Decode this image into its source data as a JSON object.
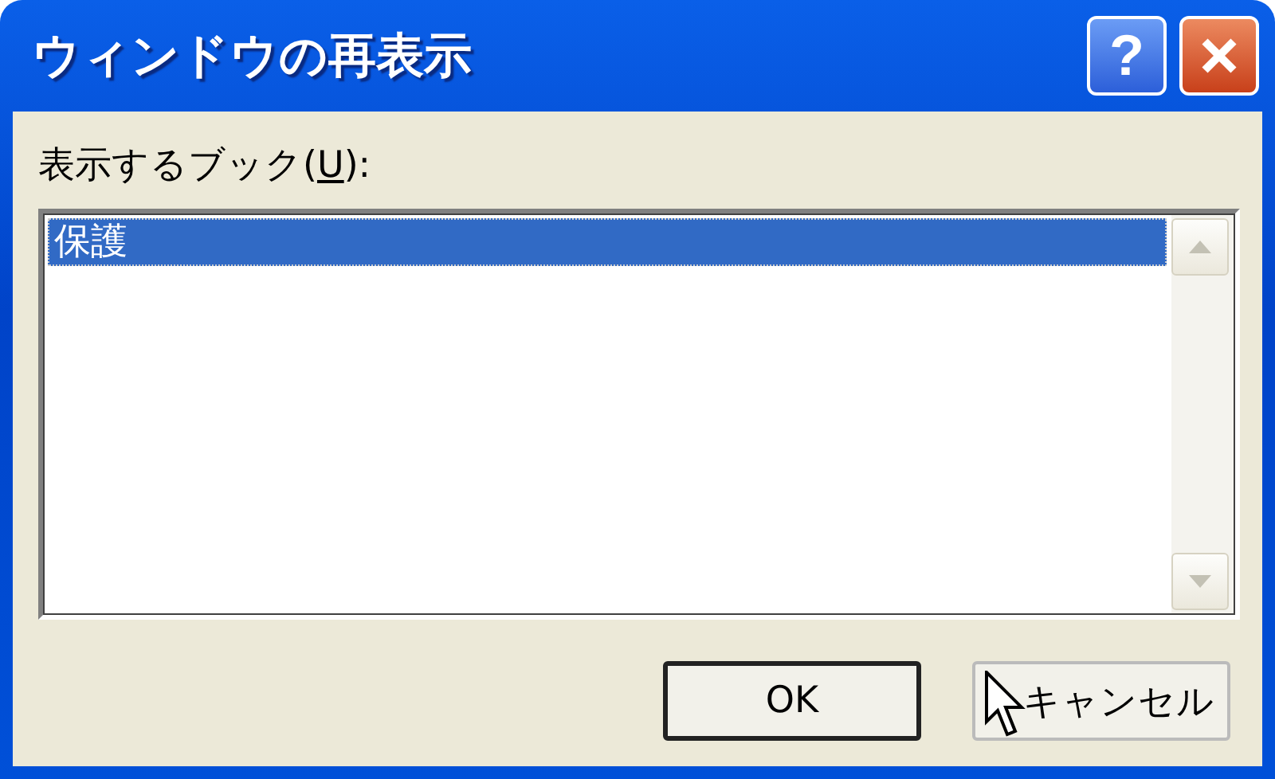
{
  "window": {
    "title": "ウィンドウの再表示"
  },
  "title_buttons": [
    {
      "kind": "help",
      "label": "?"
    },
    {
      "kind": "close"
    }
  ],
  "list_label": {
    "before": "表示するブック(",
    "mnemonic": "U",
    "after": "):"
  },
  "list": {
    "items": [
      {
        "label": "保護",
        "selected": true
      }
    ]
  },
  "buttons": [
    {
      "label": "OK",
      "default": true
    },
    {
      "label": "キャンセル",
      "default": false
    }
  ]
}
